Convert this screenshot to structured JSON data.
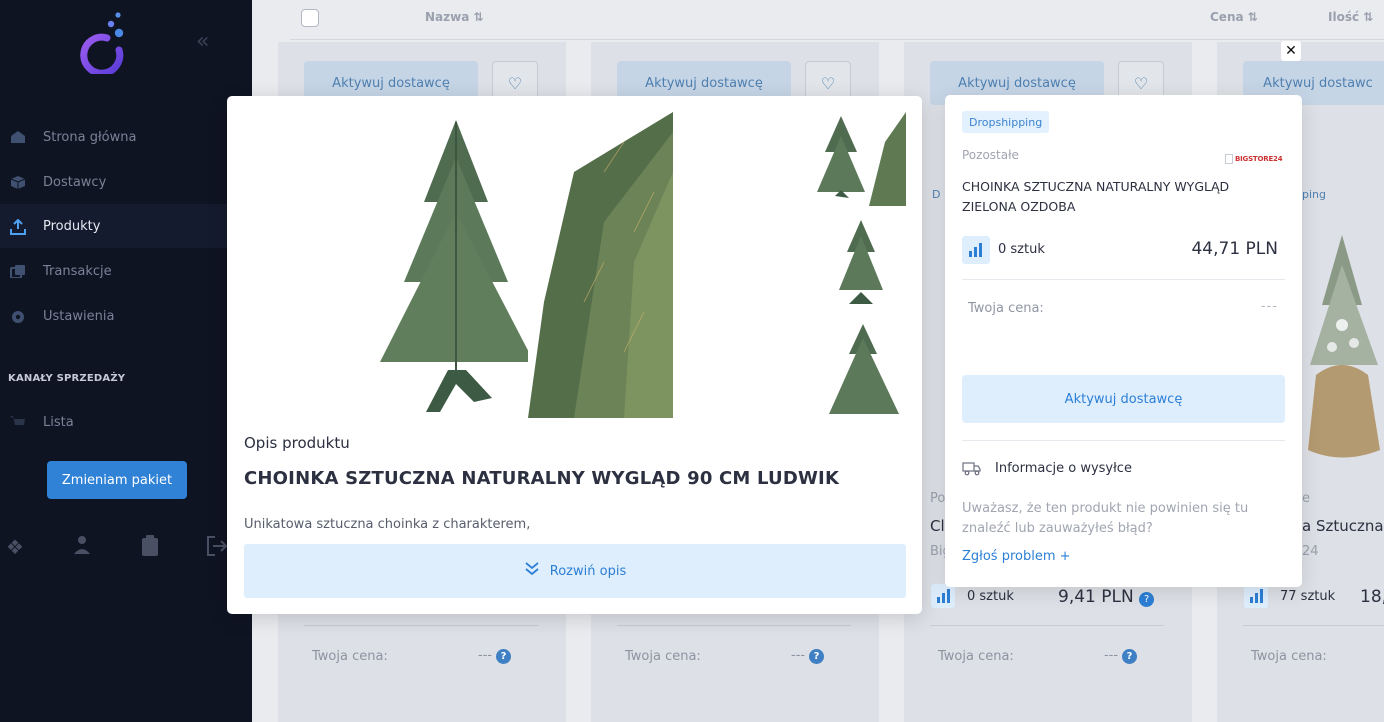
{
  "sidebar": {
    "items": [
      {
        "label": "Strona główna",
        "icon": "home-icon"
      },
      {
        "label": "Dostawcy",
        "icon": "box-icon"
      },
      {
        "label": "Produkty",
        "icon": "upload-tray-icon"
      },
      {
        "label": "Transakcje",
        "icon": "copy-icon"
      },
      {
        "label": "Ustawienia",
        "icon": "gear-icon"
      }
    ],
    "section_label": "KANAŁY SPRZEDAŻY",
    "channel_item": "Lista",
    "package_button": "Zmieniam pakiet",
    "active_item": "Produkty"
  },
  "table_header": {
    "name_col": "Nazwa ⇅",
    "price_col": "Cena ⇅",
    "qty_col": "Ilość ⇅"
  },
  "bg_cards": {
    "activate_label": "Aktywuj dostawcę",
    "activate_label_partial": "Aktywuj dostawc",
    "your_price_label": "Twoja cena:",
    "your_price_value": "---",
    "frag_badge_mid": "D",
    "frag_badge_right": "ping",
    "frag_po": "Po",
    "frag_cl": "Cl",
    "frag_big": "Big",
    "frag_stock_mid": "0 sztuk",
    "frag_price_mid": "9,41 PLN",
    "frag_e": "e",
    "frag_sztuczna": "a Sztuczna",
    "frag_24": "24",
    "frag_stock_right": "77 sztuk",
    "frag_price_right": "18,"
  },
  "modal": {
    "description_label": "Opis produktu",
    "product_title": "CHOINKA SZTUCZNA NATURALNY WYGLĄD 90 CM LUDWIK",
    "description_preview": "Unikatowa sztuczna choinka z charakterem,",
    "expand_button": "Rozwiń opis"
  },
  "panel": {
    "badge": "Dropshipping",
    "category": "Pozostałe",
    "supplier_logo_text": "BIGSTORE24",
    "title": "CHOINKA SZTUCZNA NATURALNY WYGLĄD ZIELONA OZDOBA",
    "stock": "0 sztuk",
    "price": "44,71 PLN",
    "your_price_label": "Twoja cena:",
    "your_price_value": "---",
    "activate_button": "Aktywuj dostawcę",
    "shipping_info": "Informacje o wysyłce",
    "report_question": "Uważasz, że ten produkt nie powinien się tu znaleźć lub zauważyłeś błąd?",
    "report_link": "Zgłoś problem +",
    "close_label": "✕"
  },
  "colors": {
    "sidebar_bg": "#0f1423",
    "accent": "#2c7fd5",
    "accent_light": "#deeefd",
    "package_button": "#2f82d6"
  }
}
